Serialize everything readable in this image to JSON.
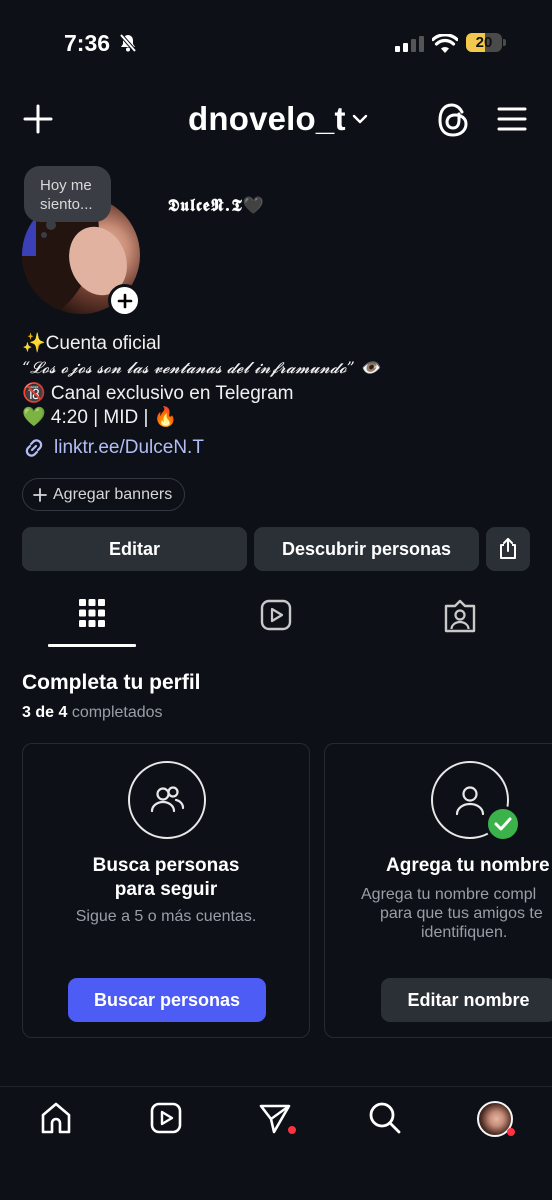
{
  "status_bar": {
    "time": "7:36",
    "battery": "20",
    "battery_level": 0.2
  },
  "header": {
    "username": "dnovelo_t"
  },
  "profile": {
    "note": "Hoy me siento...",
    "display_name": "𝕯𝖚𝖑𝖈𝖊𝕹.𝕿🖤",
    "bio_lines": [
      "✨Cuenta oficial",
      "“𝓛𝓸𝓼 𝓸𝓳𝓸𝓼 𝓼𝓸𝓷 𝓵𝓪𝓼 𝓿𝓮𝓷𝓽𝓪𝓷𝓪𝓼 𝓭𝓮𝓵 𝓲𝓷𝓯𝓻𝓪𝓶𝓾𝓷𝓭𝓸” 👁️",
      "🔞 Canal exclusivo en Telegram",
      "💚 4:20 | MID | 🔥"
    ],
    "link": "linktr.ee/DulceN.T",
    "add_banners": "Agregar banners"
  },
  "actions": {
    "edit": "Editar",
    "discover": "Descubrir personas"
  },
  "tabs": [
    "grid-icon",
    "reels-icon",
    "tagged-icon"
  ],
  "complete_profile": {
    "title": "Completa tu perfil",
    "progress_bold": "3 de 4",
    "progress_rest": "completados",
    "cards": [
      {
        "title_line1": "Busca personas",
        "title_line2": "para seguir",
        "desc_line1": "Sigue a 5 o más cuentas.",
        "button": "Buscar personas"
      },
      {
        "title_line1": "Agrega tu nombre",
        "desc_line1": "Agrega tu nombre compl",
        "desc_line2": "para que tus amigos te",
        "desc_line3": "identifiquen.",
        "button": "Editar nombre"
      }
    ]
  },
  "colors": {
    "background": "#0d1117",
    "accent_button": "#4c5cf5",
    "link": "#b3bdf5",
    "check": "#3bb34a"
  }
}
